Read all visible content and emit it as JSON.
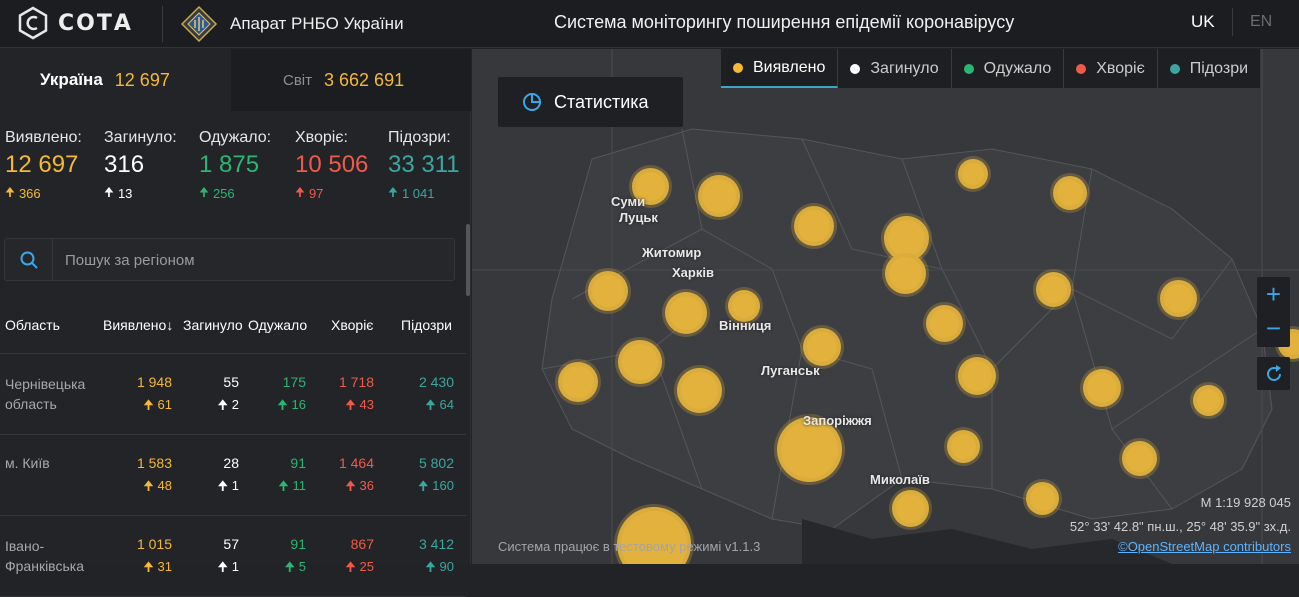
{
  "header": {
    "logo_text": "СОТА",
    "org_name": "Апарат РНБО України",
    "title": "Система моніторингу поширення епідемії коронавірусу",
    "lang_uk": "UK",
    "lang_en": "EN"
  },
  "scope": {
    "ukraine_label": "Україна",
    "ukraine_value": "12 697",
    "world_label": "Світ",
    "world_value": "3 662 691"
  },
  "stats": [
    {
      "label": "Виявлено:",
      "value": "12 697",
      "delta": "366",
      "color": "#f4b935"
    },
    {
      "label": "Загинуло:",
      "value": "316",
      "delta": "13",
      "color": "#ffffff"
    },
    {
      "label": "Одужало:",
      "value": "1 875",
      "delta": "256",
      "color": "#2bb673"
    },
    {
      "label": "Хворіє:",
      "value": "10 506",
      "delta": "97",
      "color": "#f05a4a"
    },
    {
      "label": "Підозри:",
      "value": "33 311",
      "delta": "1 041",
      "color": "#3aa7a0"
    }
  ],
  "search": {
    "placeholder": "Пошук за регіоном"
  },
  "table": {
    "headers": [
      "Область",
      "Виявлено",
      "Загинуло",
      "Одужало",
      "Хворіє",
      "Підозри"
    ],
    "sort_icon": "↓",
    "rows": [
      {
        "name": "Чернівецька область",
        "detected": "1 948",
        "detected_d": "61",
        "dead": "55",
        "dead_d": "2",
        "recovered": "175",
        "recovered_d": "16",
        "sick": "1 718",
        "sick_d": "43",
        "suspect": "2 430",
        "suspect_d": "64"
      },
      {
        "name": "м. Київ",
        "detected": "1 583",
        "detected_d": "48",
        "dead": "28",
        "dead_d": "1",
        "recovered": "91",
        "recovered_d": "11",
        "sick": "1 464",
        "sick_d": "36",
        "suspect": "5 802",
        "suspect_d": "160"
      },
      {
        "name": "Івано-Франківська",
        "detected": "1 015",
        "detected_d": "31",
        "dead": "57",
        "dead_d": "1",
        "recovered": "91",
        "recovered_d": "5",
        "sick": "867",
        "sick_d": "25",
        "suspect": "3 412",
        "suspect_d": "90"
      }
    ]
  },
  "map": {
    "stat_button": "Статистика",
    "legend": [
      {
        "label": "Виявлено",
        "color": "#f4b935",
        "active": true
      },
      {
        "label": "Загинуло",
        "color": "#ffffff",
        "active": false
      },
      {
        "label": "Одужало",
        "color": "#2bb673",
        "active": false
      },
      {
        "label": "Хворіє",
        "color": "#f05a4a",
        "active": false
      },
      {
        "label": "Підозри",
        "color": "#3aa7a0",
        "active": false
      }
    ],
    "zoom_in": "+",
    "zoom_out": "−",
    "version": "Система працює в тестовому режимі v1.1.3",
    "scale": "M 1:19 928 045",
    "coords": "52° 33' 42.8\" пн.ш., 25° 48' 35.9\" зх.д.",
    "osm": "©OpenStreetMap contributors",
    "cities": [
      "Суми",
      "Луцьк",
      "Житомир",
      "Харків",
      "Вінниця",
      "Луганськ",
      "Запоріжжя",
      "Миколаїв"
    ]
  }
}
